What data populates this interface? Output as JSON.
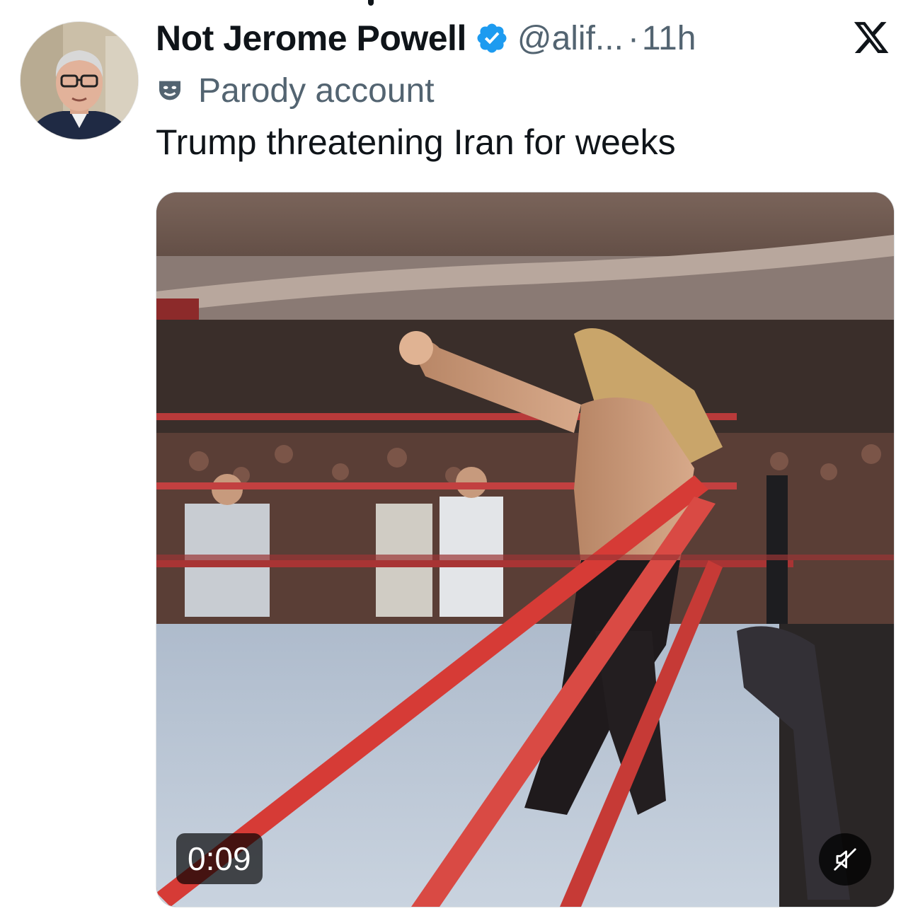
{
  "tweet": {
    "display_name": "Not Jerome Powell",
    "handle": "@alif...",
    "separator": "·",
    "time": "11h",
    "verified_icon": "verified-badge-icon",
    "parody_label": "Parody account",
    "parody_icon": "theater-mask-icon",
    "text": "Trump threatening Iran for weeks",
    "platform_icon": "x-logo-icon"
  },
  "media": {
    "type": "video",
    "duration": "0:09",
    "mute_icon": "speaker-muted-icon"
  },
  "colors": {
    "text_primary": "#0f1419",
    "text_secondary": "#536471",
    "verified_blue": "#1d9bf0",
    "background": "#ffffff"
  }
}
